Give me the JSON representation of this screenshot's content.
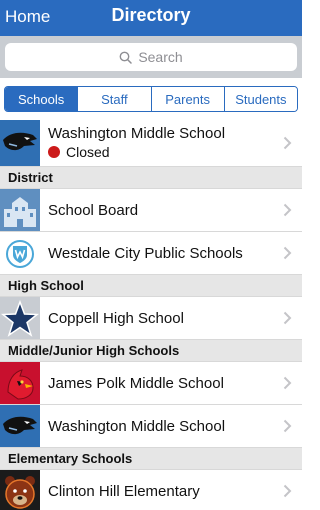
{
  "navbar": {
    "back_label": "Home",
    "title": "Directory"
  },
  "search": {
    "placeholder": "Search"
  },
  "tabs": [
    {
      "label": "Schools",
      "active": true
    },
    {
      "label": "Staff",
      "active": false
    },
    {
      "label": "Parents",
      "active": false
    },
    {
      "label": "Students",
      "active": false
    }
  ],
  "featured": {
    "name": "Washington Middle School",
    "status": "Closed",
    "status_color": "#cc1a1a",
    "icon": "panther-logo-icon"
  },
  "sections": [
    {
      "title": "District",
      "items": [
        {
          "name": "School Board",
          "icon": "school-building-icon"
        },
        {
          "name": "Westdale City Public Schools",
          "icon": "district-crest-icon"
        }
      ]
    },
    {
      "title": "High School",
      "items": [
        {
          "name": "Coppell High School",
          "icon": "star-logo-icon"
        }
      ]
    },
    {
      "title": "Middle/Junior High Schools",
      "items": [
        {
          "name": "James Polk Middle School",
          "icon": "cardinal-logo-icon"
        },
        {
          "name": "Washington Middle School",
          "icon": "panther-logo-icon"
        }
      ]
    },
    {
      "title": "Elementary Schools",
      "items": [
        {
          "name": "Clinton Hill Elementary",
          "icon": "bear-logo-icon"
        }
      ]
    }
  ],
  "colors": {
    "accent": "#2a6bbf",
    "section_bg": "#e6e6e6",
    "search_bg": "#c9cdd2"
  }
}
